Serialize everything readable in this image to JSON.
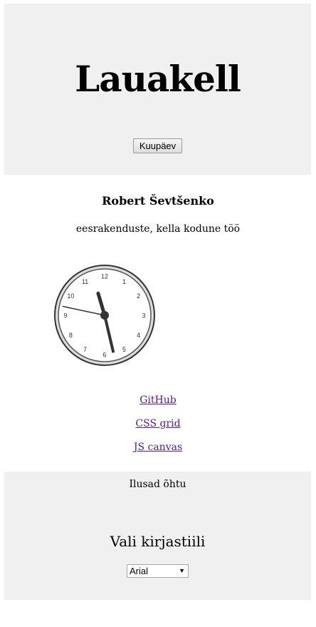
{
  "header": {
    "title": "Lauakell",
    "date_button": "Kuupäev"
  },
  "author": "Robert Ševtšenko",
  "subtitle": "eesrakenduste, kella kodune töö",
  "clock": {
    "numbers": [
      "12",
      "1",
      "2",
      "3",
      "4",
      "5",
      "6",
      "7",
      "8",
      "9",
      "10",
      "11"
    ],
    "time": {
      "hour": 11,
      "minute": 27,
      "second": 47
    },
    "colors": {
      "face": "#ffffff",
      "rim": "#333333",
      "hands": "#333333"
    }
  },
  "links": [
    {
      "label": "GitHub"
    },
    {
      "label": "CSS grid"
    },
    {
      "label": "JS canvas"
    }
  ],
  "footer": {
    "greeting": "Ilusad õhtu",
    "font_heading": "Vali kirjastiili",
    "font_select_value": "Arial"
  },
  "colors": {
    "panel_bg": "#f0f0f0",
    "link": "#551a8b"
  }
}
